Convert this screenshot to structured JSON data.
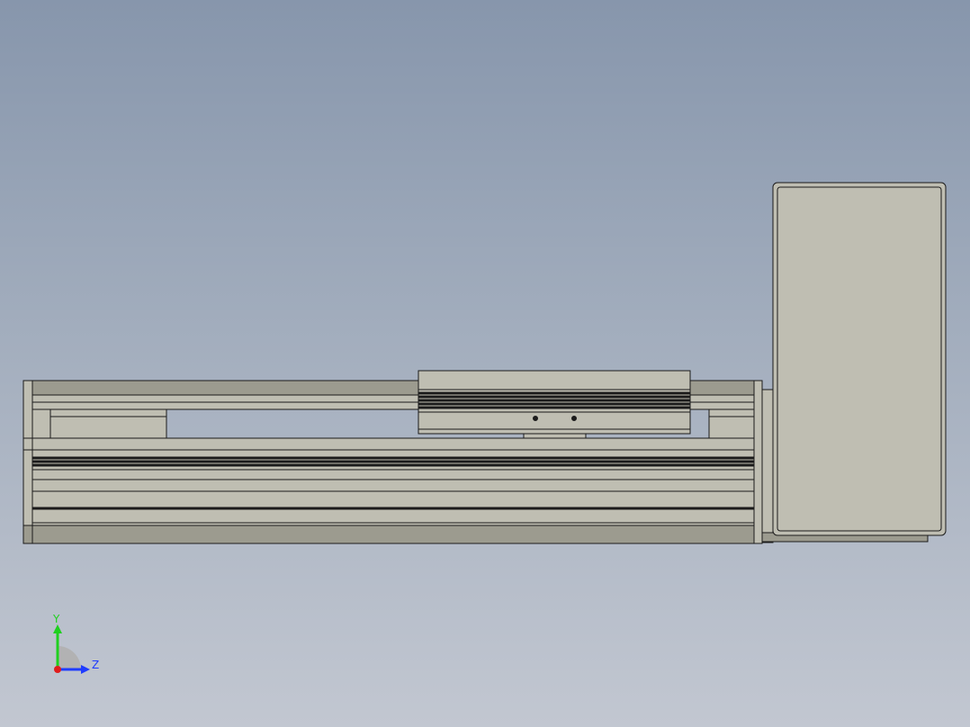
{
  "viewport": {
    "background_top": "#8796ac",
    "background_bottom": "#c2c7d1"
  },
  "model": {
    "body_color": "#bfbeb2",
    "dark_color": "#9c9b8f",
    "edge_color": "#1b1b1b"
  },
  "triad": {
    "y_label": "Y",
    "z_label": "Z",
    "y_color": "#1fd01f",
    "z_color": "#1f3cff",
    "origin_color": "#e01c1c"
  }
}
